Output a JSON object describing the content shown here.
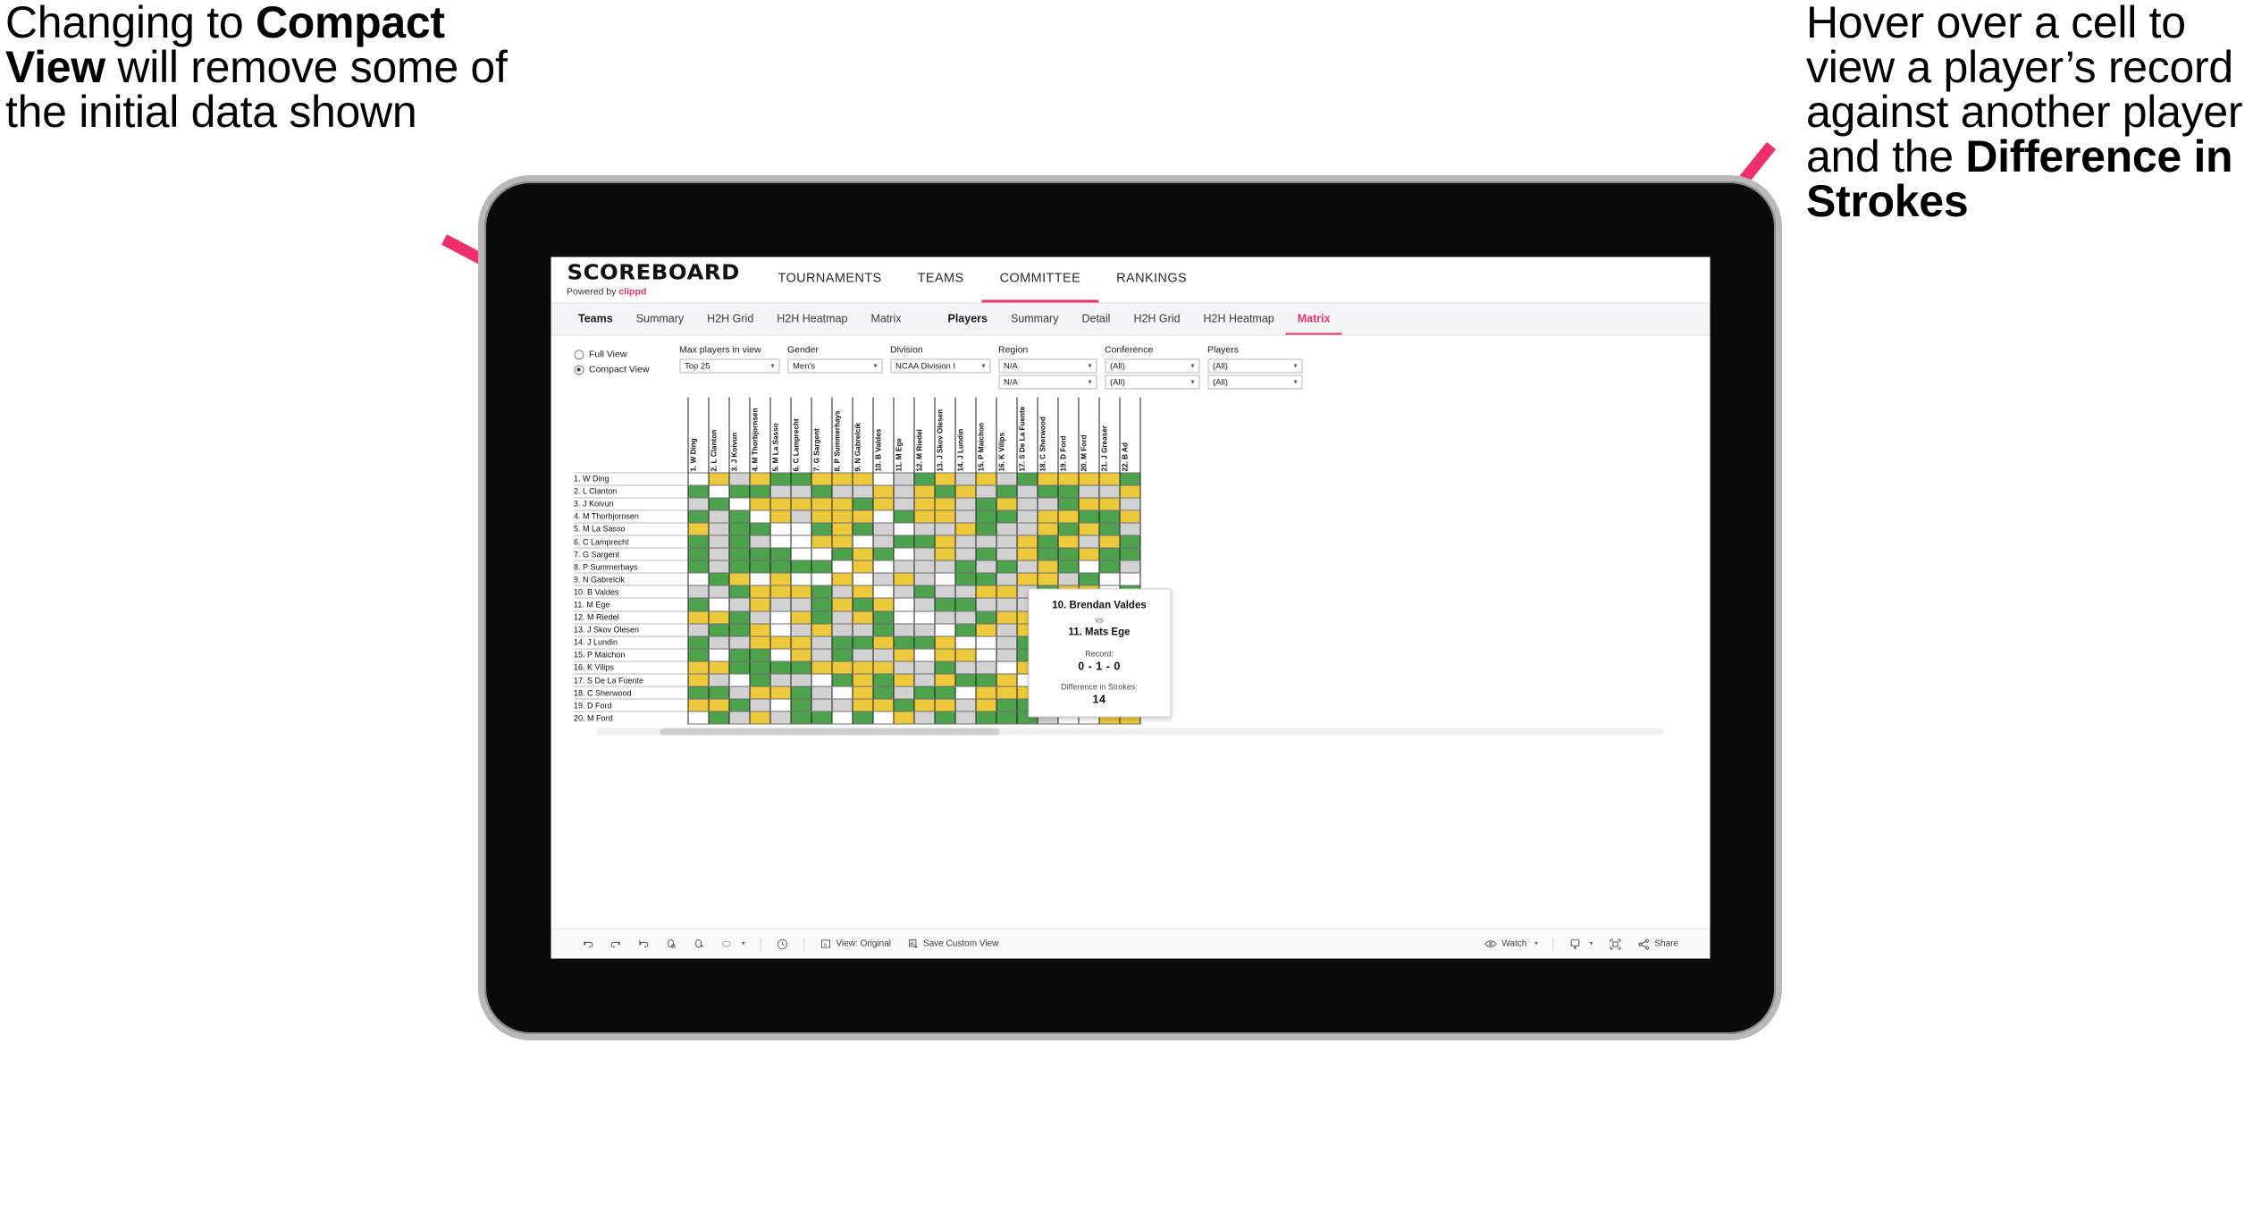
{
  "annotations": {
    "left": {
      "line1": "Changing to ",
      "bold": "Compact View",
      "line2": " will remove some of the initial data shown"
    },
    "right": {
      "line1": "Hover over a cell to view a player’s record against another player and the ",
      "bold": "Difference in Strokes",
      "line2": ""
    },
    "arrow_color": "#ef2f6b"
  },
  "app": {
    "logo": {
      "word": "SCOREBOARD",
      "powered_prefix": "Powered by ",
      "brand": "clippd"
    },
    "nav_tabs": [
      {
        "label": "TOURNAMENTS",
        "active": false
      },
      {
        "label": "TEAMS",
        "active": false
      },
      {
        "label": "COMMITTEE",
        "active": true
      },
      {
        "label": "RANKINGS",
        "active": false
      }
    ],
    "sub_tabs_teams": [
      {
        "label": "Teams",
        "head": true,
        "active": false
      },
      {
        "label": "Summary",
        "head": false,
        "active": false
      },
      {
        "label": "H2H Grid",
        "head": false,
        "active": false
      },
      {
        "label": "H2H Heatmap",
        "head": false,
        "active": false
      },
      {
        "label": "Matrix",
        "head": false,
        "active": false
      }
    ],
    "sub_tabs_players": [
      {
        "label": "Players",
        "head": true,
        "active": false
      },
      {
        "label": "Summary",
        "head": false,
        "active": false
      },
      {
        "label": "Detail",
        "head": false,
        "active": false
      },
      {
        "label": "H2H Grid",
        "head": false,
        "active": false
      },
      {
        "label": "H2H Heatmap",
        "head": false,
        "active": false
      },
      {
        "label": "Matrix",
        "head": false,
        "active": true
      }
    ]
  },
  "filters": {
    "view_mode": {
      "full_label": "Full View",
      "compact_label": "Compact View",
      "selected": "Compact View"
    },
    "fields": [
      {
        "label": "Max players in view",
        "values": [
          "Top 25"
        ],
        "width_class": "w-max"
      },
      {
        "label": "Gender",
        "values": [
          "Men’s"
        ],
        "width_class": "w-gender"
      },
      {
        "label": "Division",
        "values": [
          "NCAA Division I"
        ],
        "width_class": "w-div"
      },
      {
        "label": "Region",
        "values": [
          "N/A",
          "N/A"
        ],
        "width_class": "w-region"
      },
      {
        "label": "Conference",
        "values": [
          "(All)",
          "(All)"
        ],
        "width_class": "w-conf"
      },
      {
        "label": "Players",
        "values": [
          "(All)",
          "(All)"
        ],
        "width_class": "w-players"
      }
    ]
  },
  "matrix": {
    "columns": [
      "1. W Ding",
      "2. L Clanton",
      "3. J Koivun",
      "4. M Thorbjornsen",
      "5. M La Sasso",
      "6. C Lamprecht",
      "7. G Sargent",
      "8. P Summerhays",
      "9. N Gabrelcik",
      "10. B Valdes",
      "11. M Ege",
      "12. M Riedel",
      "13. J Skov Olesen",
      "14. J Lundin",
      "15. P Maichon",
      "16. K Vilips",
      "17. S De La Fuente",
      "18. C Sherwood",
      "19. D Ford",
      "20. M Ford",
      "21. J Greaser",
      "22. B Ad"
    ],
    "rows": [
      "1. W Ding",
      "2. L Clanton",
      "3. J Koivun",
      "4. M Thorbjornsen",
      "5. M La Sasso",
      "6. C Lamprecht",
      "7. G Sargent",
      "8. P Summerhays",
      "9. N Gabrelcik",
      "10. B Valdes",
      "11. M Ege",
      "12. M Riedel",
      "13. J Skov Olesen",
      "14. J Lundin",
      "15. P Maichon",
      "16. K Vilips",
      "17. S De La Fuente",
      "18. C Sherwood",
      "19. D Ford",
      "20. M Ford"
    ],
    "legend_colors": {
      "win": "#4ea24e",
      "tie": "#edc93c",
      "loss": "#d2d2d2",
      "none": "#ffffff"
    },
    "cells": [
      "wyayggyyywagyayagyyyyg",
      "gwggaagaayaygyagaggaay",
      "agwyyyyygyayyagyaagyya",
      "gagwyayyywgyyaggayyggy",
      "yaggwwgygawaaygaaygyga",
      "gagawwyywaggyaaaygyayg",
      "gagggwwgygwayagayggygg",
      "gagggggwywaaagagaygwga",
      "wgywywwywayawggayyagww",
      "aagyyygaywagaayyagyywg",
      "gwayaagygywaggaaaggygy",
      "yygawygaygwwaagyywagaa",
      "aggywayaagaawgyayyyyyg",
      "gaayyyaggyggywwagyyagy",
      "gwggwyagaaywyywaggayyg",
      "yyggggyyyyaagaawygagwy",
      "yawgaawgygyayggywwggay",
      "ggayygawygaggwyyygwyaa",
      "yygawgaayygyyayggwwayg",
      "wgayaggwgwyagagggawwyy"
    ]
  },
  "tooltip": {
    "player_a": "10. Brendan Valdes",
    "vs": "vs",
    "player_b": "11. Mats Ege",
    "record_label": "Record:",
    "record_value": "0 - 1 - 0",
    "diff_label": "Difference in Strokes:",
    "diff_value": "14"
  },
  "toolbar": {
    "left_icons": [
      "undo-icon",
      "redo-icon",
      "revert-icon",
      "refresh-icon",
      "pause-icon",
      "shape-icon"
    ],
    "shape_caret": "▾",
    "clock_icon": "clock-icon",
    "view_label": "View: Original",
    "save_label": "Save Custom View",
    "watch_label": "Watch",
    "watch_caret": "▾",
    "download_caret": "▾",
    "share_label": "Share"
  }
}
